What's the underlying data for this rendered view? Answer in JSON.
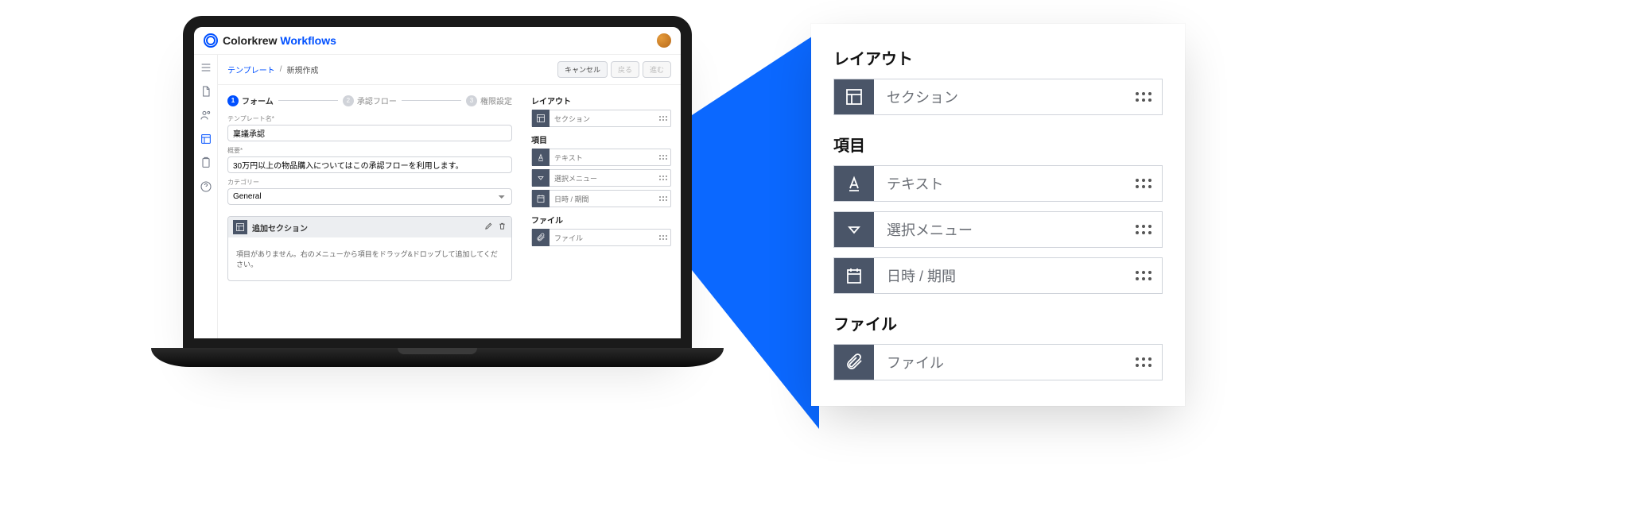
{
  "app": {
    "brand_a": "Colorkrew",
    "brand_b": "Workflows"
  },
  "breadcrumb": {
    "link": "テンプレート",
    "sep": "/",
    "current": "新規作成"
  },
  "actions": {
    "cancel": "キャンセル",
    "back": "戻る",
    "next": "進む"
  },
  "stepper": {
    "s1": {
      "n": "1",
      "label": "フォーム"
    },
    "s2": {
      "n": "2",
      "label": "承認フロー"
    },
    "s3": {
      "n": "3",
      "label": "権限設定"
    }
  },
  "form": {
    "name_label": "テンプレート名*",
    "name_value": "稟議承認",
    "desc_label": "概要*",
    "desc_value": "30万円以上の物品購入についてはこの承認フローを利用します。",
    "cat_label": "カテゴリー",
    "cat_value": "General"
  },
  "section": {
    "title": "追加セクション",
    "empty": "項目がありません。右のメニューから項目をドラッグ&ドロップして追加してください。"
  },
  "palette": {
    "layout_title": "レイアウト",
    "section": "セクション",
    "items_title": "項目",
    "text": "テキスト",
    "select": "選択メニュー",
    "datetime": "日時 / 期間",
    "file_title": "ファイル",
    "file": "ファイル"
  }
}
